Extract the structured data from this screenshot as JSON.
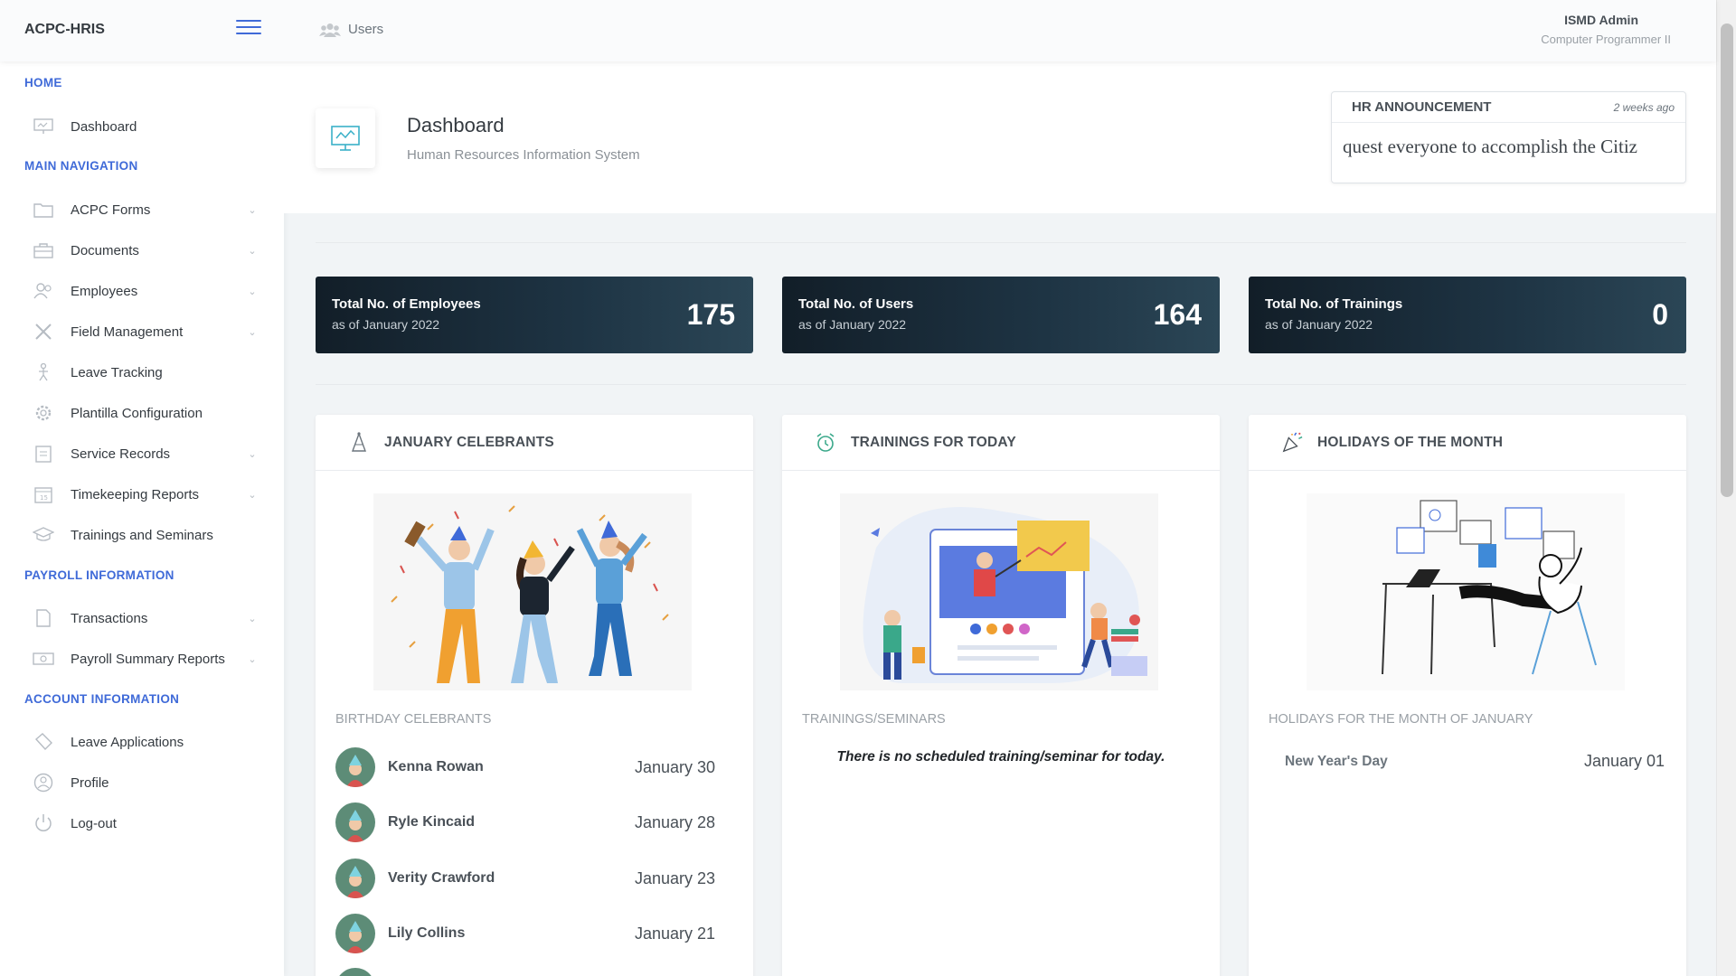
{
  "app": {
    "title": "ACPC-HRIS"
  },
  "header": {
    "breadcrumb": "Users",
    "user_name": "ISMD Admin",
    "user_role": "Computer Programmer II"
  },
  "sidebar": {
    "sections": [
      {
        "heading": "HOME",
        "items": [
          {
            "label": "Dashboard",
            "icon": "presentation-icon",
            "chevron": false
          }
        ]
      },
      {
        "heading": "MAIN NAVIGATION",
        "items": [
          {
            "label": "ACPC Forms",
            "icon": "folder-icon",
            "chevron": true
          },
          {
            "label": "Documents",
            "icon": "briefcase-icon",
            "chevron": true
          },
          {
            "label": "Employees",
            "icon": "users-icon",
            "chevron": true
          },
          {
            "label": "Field Management",
            "icon": "tools-icon",
            "chevron": true
          },
          {
            "label": "Leave Tracking",
            "icon": "hiker-icon",
            "chevron": false
          },
          {
            "label": "Plantilla Configuration",
            "icon": "gear-icon",
            "chevron": false
          },
          {
            "label": "Service Records",
            "icon": "clipboard-icon",
            "chevron": true
          },
          {
            "label": "Timekeeping Reports",
            "icon": "calendar-icon",
            "chevron": true
          },
          {
            "label": "Trainings and Seminars",
            "icon": "graduation-cap-icon",
            "chevron": false
          }
        ]
      },
      {
        "heading": "PAYROLL INFORMATION",
        "items": [
          {
            "label": "Transactions",
            "icon": "document-icon",
            "chevron": true
          },
          {
            "label": "Payroll Summary Reports",
            "icon": "money-icon",
            "chevron": true
          }
        ]
      },
      {
        "heading": "ACCOUNT INFORMATION",
        "items": [
          {
            "label": "Leave Applications",
            "icon": "ticket-icon",
            "chevron": false
          },
          {
            "label": "Profile",
            "icon": "user-circle-icon",
            "chevron": false
          },
          {
            "label": "Log-out",
            "icon": "power-icon",
            "chevron": false
          }
        ]
      }
    ]
  },
  "page": {
    "title": "Dashboard",
    "subtitle": "Human Resources Information System"
  },
  "announcement": {
    "title": "HR ANNOUNCEMENT",
    "time": "2 weeks ago",
    "text": "quest everyone to accomplish the Citiz"
  },
  "stats": [
    {
      "title": "Total No. of Employees",
      "sub": "as of January 2022",
      "value": "175"
    },
    {
      "title": "Total No. of Users",
      "sub": "as of January 2022",
      "value": "164"
    },
    {
      "title": "Total No. of Trainings",
      "sub": "as of January 2022",
      "value": "0"
    }
  ],
  "celebrants": {
    "title": "JANUARY CELEBRANTS",
    "label": "BIRTHDAY CELEBRANTS",
    "list": [
      {
        "name": "Kenna Rowan",
        "date": "January 30"
      },
      {
        "name": "Ryle Kincaid",
        "date": "January 28"
      },
      {
        "name": "Verity Crawford",
        "date": "January 23"
      },
      {
        "name": "Lily Collins",
        "date": "January 21"
      }
    ]
  },
  "trainings": {
    "title": "TRAININGS FOR TODAY",
    "label": "TRAININGS/SEMINARS",
    "empty": "There is no scheduled training/seminar for today."
  },
  "holidays": {
    "title": "HOLIDAYS OF THE MONTH",
    "label": "HOLIDAYS FOR THE MONTH OF JANUARY",
    "list": [
      {
        "name": "New Year's Day",
        "date": "January 01"
      }
    ]
  },
  "colors": {
    "accent": "#3f6ad8",
    "stat_dark": "#1e3444",
    "avatar": "#5d8c77"
  }
}
